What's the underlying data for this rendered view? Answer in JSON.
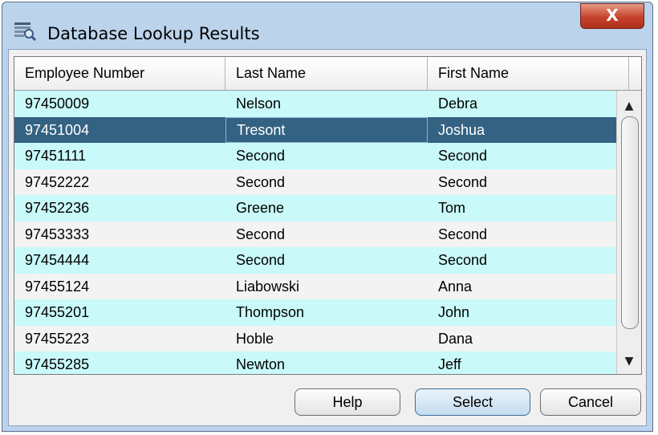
{
  "window": {
    "title": "Database Lookup Results",
    "close_label": "X",
    "icon": "database-lookup-icon"
  },
  "table": {
    "columns": [
      "Employee Number",
      "Last Name",
      "First Name"
    ],
    "rows": [
      [
        "97450009",
        "Nelson",
        "Debra"
      ],
      [
        "97451004",
        "Tresont",
        "Joshua"
      ],
      [
        "97451111",
        "Second",
        "Second"
      ],
      [
        "97452222",
        "Second",
        "Second"
      ],
      [
        "97452236",
        "Greene",
        "Tom"
      ],
      [
        "97453333",
        "Second",
        "Second"
      ],
      [
        "97454444",
        "Second",
        "Second"
      ],
      [
        "97455124",
        "Liabowski",
        "Anna"
      ],
      [
        "97455201",
        "Thompson",
        "John"
      ],
      [
        "97455223",
        "Hoble",
        "Dana"
      ],
      [
        "97455285",
        "Newton",
        "Jeff"
      ]
    ],
    "selected_index": 1,
    "scroll_up": "▲",
    "scroll_down": "▼"
  },
  "buttons": {
    "help": "Help",
    "select": "Select",
    "cancel": "Cancel"
  },
  "colors": {
    "row_odd": "#c9f9f9",
    "row_even": "#f3f3f3",
    "row_selected": "#346283"
  }
}
